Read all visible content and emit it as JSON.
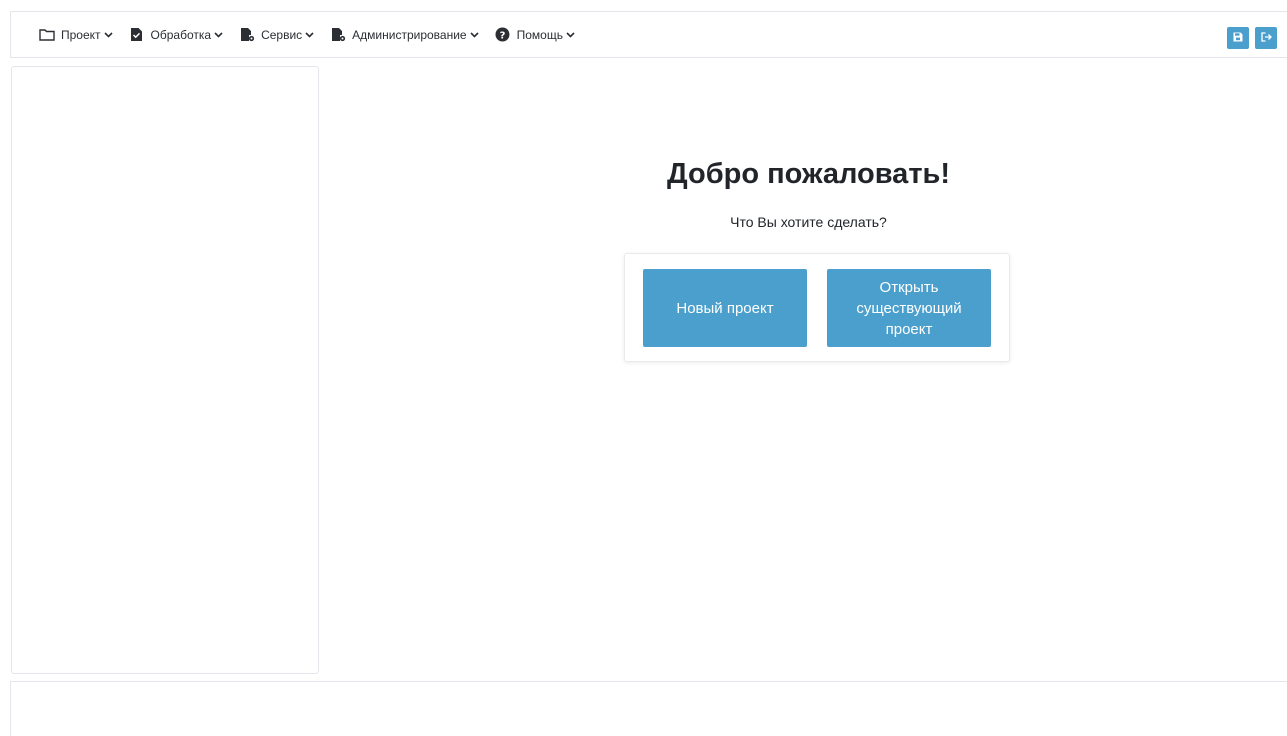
{
  "menu": {
    "items": [
      {
        "label": "Проект",
        "icon": "folder-icon"
      },
      {
        "label": "Обработка",
        "icon": "file-check-icon"
      },
      {
        "label": "Сервис",
        "icon": "file-gear-icon"
      },
      {
        "label": "Администрирование",
        "icon": "file-gear-icon"
      },
      {
        "label": "Помощь",
        "icon": "question-circle-icon"
      }
    ]
  },
  "actions": {
    "save_icon": "save-icon",
    "logout_icon": "logout-icon"
  },
  "welcome": {
    "title": "Добро пожаловать!",
    "subtitle": "Что Вы хотите сделать?",
    "new_project": "Новый проект",
    "open_project": "Открыть существующий проект"
  },
  "colors": {
    "accent": "#4a9fcc",
    "border": "#e3e6ea"
  }
}
